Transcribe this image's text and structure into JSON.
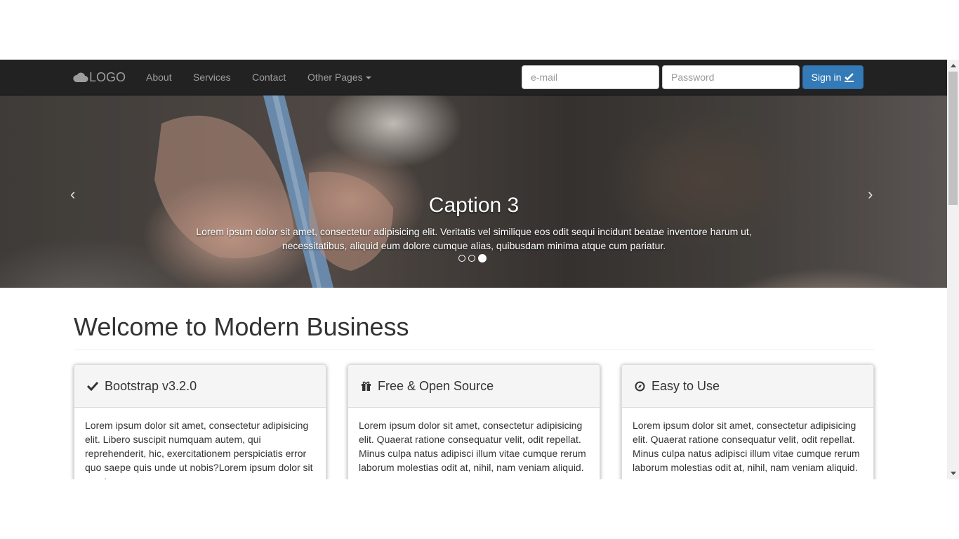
{
  "navbar": {
    "brand": "LOGO",
    "links": {
      "about": "About",
      "services": "Services",
      "contact": "Contact",
      "other_pages": "Other Pages"
    },
    "email_placeholder": "e-mail",
    "password_placeholder": "Password",
    "signin_label": "Sign in"
  },
  "carousel": {
    "prev": "‹",
    "next": "›",
    "caption_title": "Caption 3",
    "caption_text": "Lorem ipsum dolor sit amet, consectetur adipisicing elit. Veritatis vel similique eos odit sequi incidunt beatae inventore harum ut, necessitatibus, aliquid eum dolore cumque alias, quibusdam minima atque cum pariatur.",
    "active_slide": 3,
    "slide_count": 3
  },
  "main": {
    "heading": "Welcome to Modern Business",
    "panels": [
      {
        "icon": "check-icon",
        "title": "Bootstrap v3.2.0",
        "body": "Lorem ipsum dolor sit amet, consectetur adipisicing elit. Libero suscipit numquam autem, qui reprehenderit, hic, exercitationem perspiciatis error quo saepe quis unde ut nobis?Lorem ipsum dolor sit amet."
      },
      {
        "icon": "gift-icon",
        "title": "Free & Open Source",
        "body": "Lorem ipsum dolor sit amet, consectetur adipisicing elit. Quaerat ratione consequatur velit, odit repellat. Minus culpa natus adipisci illum vitae cumque rerum laborum molestias odit at, nihil, nam veniam aliquid."
      },
      {
        "icon": "compass-icon",
        "title": "Easy to Use",
        "body": "Lorem ipsum dolor sit amet, consectetur adipisicing elit. Quaerat ratione consequatur velit, odit repellat. Minus culpa natus adipisci illum vitae cumque rerum laborum molestias odit at, nihil, nam veniam aliquid."
      }
    ]
  },
  "colors": {
    "navbar_bg": "#222222",
    "primary": "#337ab7",
    "nav_text": "#9d9d9d"
  }
}
